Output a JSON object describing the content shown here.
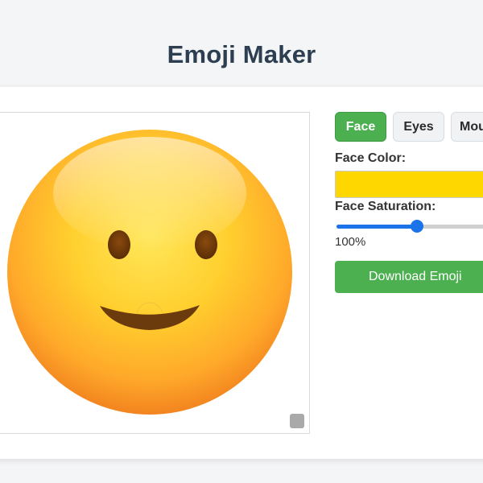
{
  "app": {
    "title": "Emoji Maker"
  },
  "tabs": [
    {
      "label": "Face",
      "active": true
    },
    {
      "label": "Eyes",
      "active": false
    },
    {
      "label": "Mou",
      "active": false
    }
  ],
  "controls": {
    "face_color_label": "Face Color:",
    "face_color_value": "#ffd700",
    "face_saturation_label": "Face Saturation:",
    "face_saturation_percent": 50,
    "face_saturation_value_text": "100%",
    "download_label": "Download Emoji"
  },
  "colors": {
    "accent_green": "#4caf50",
    "slider_blue": "#1a73e8",
    "title_text": "#2c3e50"
  },
  "icons": {
    "canvas_resize": "resize-handle-icon"
  }
}
